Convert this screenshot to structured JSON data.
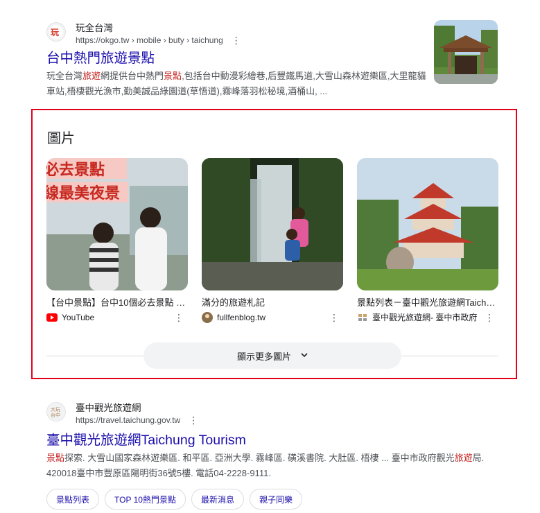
{
  "result1": {
    "site_name": "玩全台灣",
    "url": "https://okgo.tw › mobile › buty › taichung",
    "favicon_icon": "okgo-logo-icon",
    "title": "台中熱門旅遊景點",
    "snippet_parts": [
      "玩全台灣",
      "旅遊",
      "網提供台中熱門",
      "景點",
      ",包括台中動漫彩繪巷,后豐鐵馬道,大雪山森林遊樂區,大里龍貓車站,梧棲觀光漁市,勤美誠品綠園道(草悟道),霧峰落羽松秘境,酒桶山, ..."
    ]
  },
  "images_section": {
    "heading": "圖片",
    "cards": [
      {
        "caption": "【台中景點】台中10個必去景點 …",
        "source": "YouTube",
        "source_icon": "youtube-icon",
        "overlay_line1": "必去景點",
        "overlay_line2": "線最美夜景"
      },
      {
        "caption": "滿分的旅遊札記",
        "source": "fullfenblog.tw",
        "source_icon": "blog-avatar-icon"
      },
      {
        "caption": "景點列表－臺中觀光旅遊網Taichung …",
        "source": "臺中觀光旅遊網- 臺中市政府",
        "source_icon": "taichung-logo-icon"
      }
    ],
    "more_button": "顯示更多圖片"
  },
  "result2": {
    "site_name": "臺中觀光旅遊網",
    "url": "https://travel.taichung.gov.tw",
    "favicon_icon": "taichung-logo-icon",
    "title": "臺中觀光旅遊網Taichung Tourism",
    "snippet_parts": [
      "景點",
      "探索. 大雪山國家森林遊樂區. 和平區. 亞洲大學. 霧峰區. 磺溪書院. 大肚區. 梧棲 ... 臺中市政府觀光",
      "旅遊",
      "局. 420018臺中市豐原區陽明街36號5樓. 電話04-2228-9111."
    ],
    "chips": [
      "景點列表",
      "TOP 10熱門景點",
      "最新消息",
      "親子同樂"
    ]
  },
  "colors": {
    "link": "#1a0dab",
    "highlight": "#c5221f",
    "box_border": "#e3001b"
  }
}
